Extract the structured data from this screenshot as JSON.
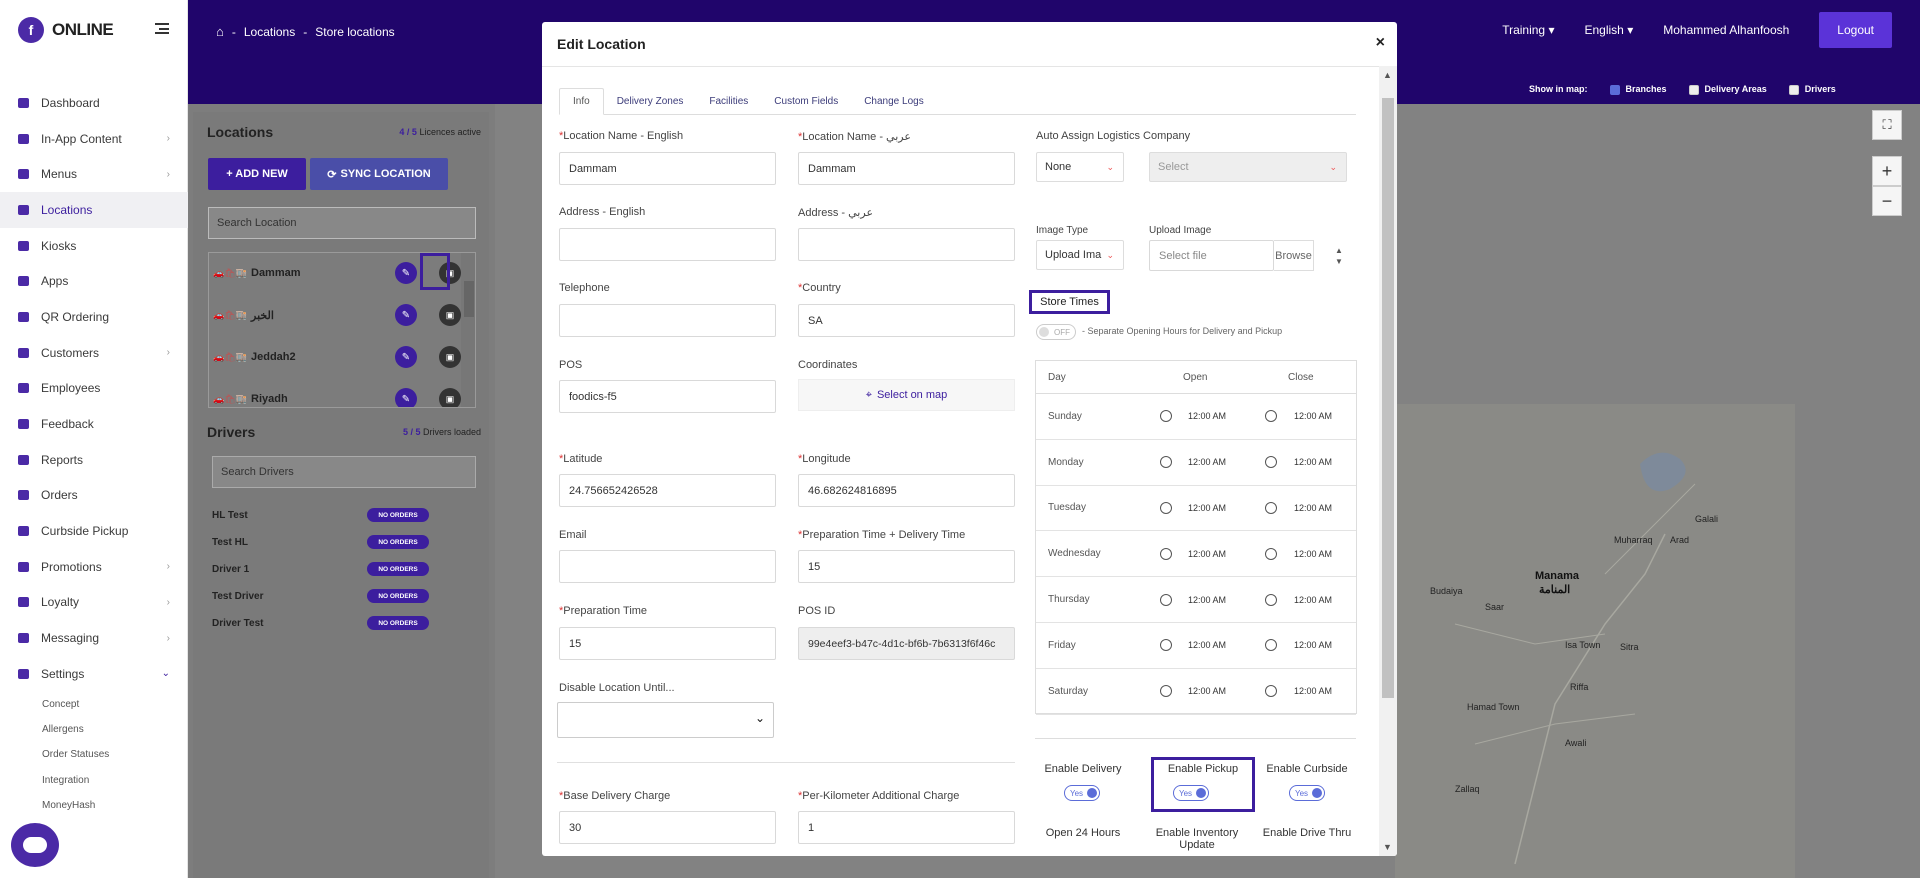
{
  "app": {
    "logo_letter": "f",
    "logo_text": "ONLINE"
  },
  "sidebar": {
    "items": [
      {
        "label": "Dashboard",
        "icon": "chart-icon",
        "chev": false
      },
      {
        "label": "In-App Content",
        "icon": "content-icon",
        "chev": true
      },
      {
        "label": "Menus",
        "icon": "menu-book-icon",
        "chev": true
      },
      {
        "label": "Locations",
        "icon": "locations-icon",
        "chev": false,
        "active": true
      },
      {
        "label": "Kiosks",
        "icon": "kiosk-icon",
        "chev": false
      },
      {
        "label": "Apps",
        "icon": "apps-icon",
        "chev": false
      },
      {
        "label": "QR Ordering",
        "icon": "qr-icon",
        "chev": false
      },
      {
        "label": "Customers",
        "icon": "customers-icon",
        "chev": true
      },
      {
        "label": "Employees",
        "icon": "employees-icon",
        "chev": false
      },
      {
        "label": "Feedback",
        "icon": "feedback-icon",
        "chev": false
      },
      {
        "label": "Reports",
        "icon": "flag-icon",
        "chev": false
      },
      {
        "label": "Orders",
        "icon": "orders-icon",
        "chev": false
      },
      {
        "label": "Curbside Pickup",
        "icon": "car-icon",
        "chev": false
      },
      {
        "label": "Promotions",
        "icon": "promotions-icon",
        "chev": true
      },
      {
        "label": "Loyalty",
        "icon": "loyalty-icon",
        "chev": true
      },
      {
        "label": "Messaging",
        "icon": "messaging-icon",
        "chev": true
      },
      {
        "label": "Settings",
        "icon": "gear-icon",
        "chev": true,
        "expanded": true
      }
    ],
    "sub_items": [
      "Concept",
      "Allergens",
      "Order Statuses",
      "Integration",
      "MoneyHash"
    ]
  },
  "header": {
    "breadcrumb": [
      "Locations",
      "Store locations"
    ],
    "training": "Training",
    "language": "English",
    "user": "Mohammed Alhanfoosh",
    "logout": "Logout"
  },
  "map_bar": {
    "label": "Show in map:",
    "branches": "Branches",
    "delivery_areas": "Delivery Areas",
    "drivers": "Drivers"
  },
  "locations_panel": {
    "title": "Locations",
    "licences_count": "4 / 5",
    "licences_label": "Licences active",
    "add_new": "+ ADD NEW",
    "sync": "SYNC LOCATION",
    "search_placeholder": "Search Location",
    "items": [
      "Dammam",
      "الخبر",
      "Jeddah2",
      "Riyadh"
    ]
  },
  "drivers_panel": {
    "title": "Drivers",
    "loaded_count": "5 / 5",
    "loaded_label": "Drivers loaded",
    "search_placeholder": "Search Drivers",
    "badge": "NO ORDERS",
    "items": [
      "HL Test",
      "Test HL",
      "Driver 1",
      "Test Driver",
      "Driver Test"
    ]
  },
  "modal": {
    "title": "Edit Location",
    "close": "×",
    "tabs": [
      "Info",
      "Delivery Zones",
      "Facilities",
      "Custom Fields",
      "Change Logs"
    ],
    "labels": {
      "name_en": "Location Name - English",
      "name_ar": "Location Name - عربي",
      "auto_assign": "Auto Assign Logistics Company",
      "address_en": "Address - English",
      "address_ar": "Address - عربي",
      "image_type": "Image Type",
      "upload_image": "Upload Image",
      "telephone": "Telephone",
      "country": "Country",
      "pos": "POS",
      "coordinates": "Coordinates",
      "latitude": "Latitude",
      "longitude": "Longitude",
      "email": "Email",
      "prep_delivery": "Preparation Time + Delivery Time",
      "prep_time": "Preparation Time",
      "pos_id": "POS ID",
      "disable_until": "Disable Location Until...",
      "base_charge": "Base Delivery Charge",
      "per_km": "Per-Kilometer Additional Charge"
    },
    "values": {
      "name_en": "Dammam",
      "name_ar": "Dammam",
      "auto_assign": "None",
      "auto_assign_company": "Select",
      "image_type": "Upload Ima",
      "upload_placeholder": "Select file",
      "browse": "Browse",
      "country": "SA",
      "pos": "foodics-f5",
      "select_on_map": "Select on map",
      "latitude": "24.756652426528",
      "longitude": "46.682624816895",
      "prep_delivery": "15",
      "prep_time": "15",
      "pos_id": "99e4eef3-b47c-4d1c-bf6b-7b6313f6f46c",
      "base_charge": "30",
      "per_km": "1"
    },
    "store_times": {
      "title": "Store Times",
      "toggle": "OFF",
      "separate_text": "- Separate Opening Hours for Delivery and Pickup",
      "head": [
        "Day",
        "Open",
        "Close"
      ],
      "rows": [
        {
          "day": "Sunday",
          "open": "12:00 AM",
          "close": "12:00 AM"
        },
        {
          "day": "Monday",
          "open": "12:00 AM",
          "close": "12:00 AM"
        },
        {
          "day": "Tuesday",
          "open": "12:00 AM",
          "close": "12:00 AM"
        },
        {
          "day": "Wednesday",
          "open": "12:00 AM",
          "close": "12:00 AM"
        },
        {
          "day": "Thursday",
          "open": "12:00 AM",
          "close": "12:00 AM"
        },
        {
          "day": "Friday",
          "open": "12:00 AM",
          "close": "12:00 AM"
        },
        {
          "day": "Saturday",
          "open": "12:00 AM",
          "close": "12:00 AM"
        }
      ]
    },
    "enables": {
      "delivery": "Enable Delivery",
      "pickup": "Enable Pickup",
      "curbside": "Enable Curbside",
      "yes": "Yes",
      "open24": "Open 24 Hours",
      "inventory": "Enable Inventory Update",
      "drive_thru": "Enable Drive Thru"
    }
  },
  "map": {
    "labels": [
      "Manama",
      "المنامة",
      "Muharraq",
      "Arad",
      "Galali",
      "Budaiya",
      "Saar",
      "Sitra",
      "Isa Town",
      "Riffa",
      "Hamad Town",
      "Zallaq",
      "Awali"
    ]
  },
  "colors": {
    "brand": "#20056b",
    "accent": "#3c1e9e",
    "toggle": "#5b6cd8"
  }
}
